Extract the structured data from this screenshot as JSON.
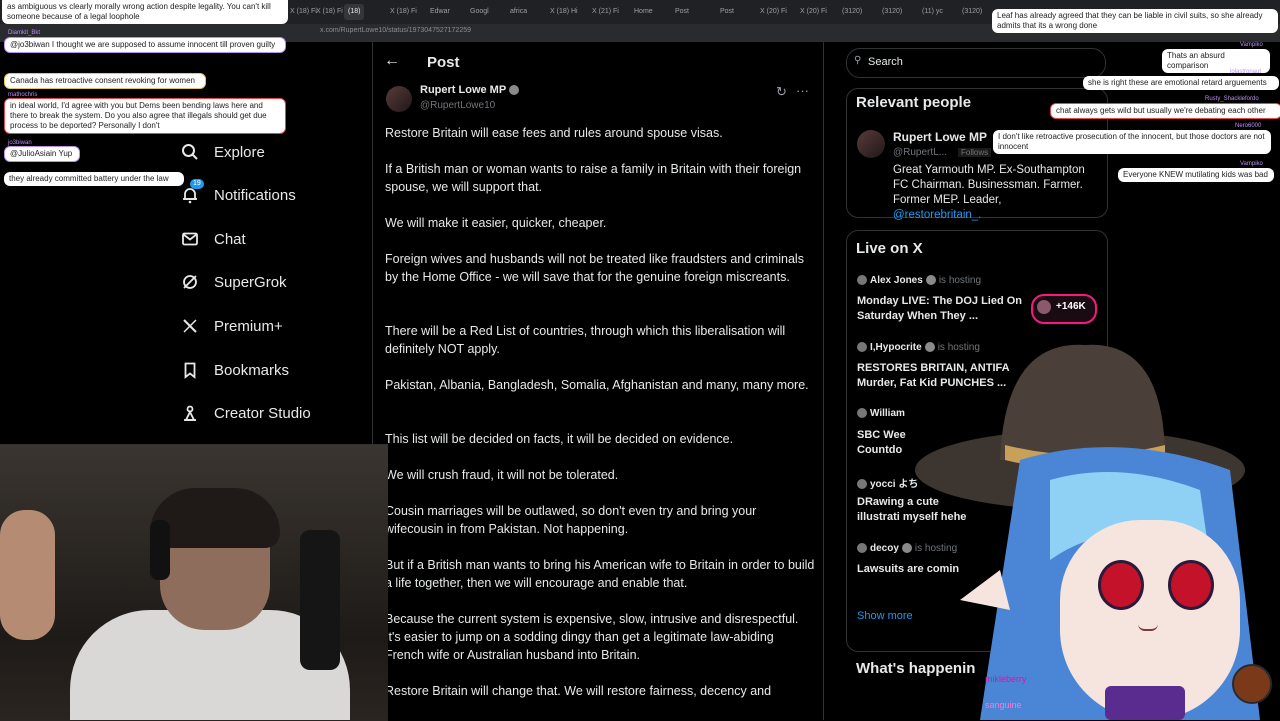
{
  "browser": {
    "tabs": [
      "X (18) Fi",
      "X (18) Fi",
      "(18)",
      "X (18) Fi",
      "Edwar",
      "Googl",
      "africa",
      "X (18) Hi",
      "X (21) Fi",
      "Home",
      "Post",
      "Post",
      "X (20) Fi",
      "X (20) Fi",
      "(3120)",
      "(3120)",
      "(11) yc",
      "(3120)"
    ],
    "url": "x.com/RupertLowe10/status/1973047527172259"
  },
  "nav": {
    "items": [
      {
        "label": "Explore",
        "icon": "search-icon"
      },
      {
        "label": "Notifications",
        "icon": "bell-icon",
        "badge": "19"
      },
      {
        "label": "Chat",
        "icon": "mail-icon"
      },
      {
        "label": "SuperGrok",
        "icon": "grok-icon"
      },
      {
        "label": "Premium+",
        "icon": "x-logo-icon"
      },
      {
        "label": "Bookmarks",
        "icon": "bookmark-icon"
      },
      {
        "label": "Creator Studio",
        "icon": "creator-icon"
      }
    ]
  },
  "post": {
    "header": "Post",
    "author": "Rupert Lowe MP",
    "handle": "@RupertLowe10",
    "paragraphs": [
      "Restore Britain will ease fees and rules around spouse visas.",
      "If a British man or woman wants to raise a family in Britain with their foreign spouse, we will support that.",
      "We will make it easier, quicker, cheaper.",
      "Foreign wives and husbands will not be treated like fraudsters and criminals by the Home Office - we will save that for the genuine foreign miscreants.",
      "There will be a Red List of countries, through which this liberalisation will definitely NOT apply.",
      "Pakistan, Albania, Bangladesh, Somalia, Afghanistan and many, many more.",
      "This list will be decided on facts, it will be decided on evidence.",
      "We will crush fraud, it will not be tolerated.",
      "Cousin marriages will be outlawed, so don't even try and bring your wifecousin in from Pakistan. Not happening.",
      "But if a British man wants to bring his American wife to Britain in order to build a life together, then we will encourage and enable that.",
      "Because the current system is expensive, slow, intrusive and disrespectful. It's easier to jump on a sodding dingy than get a legitimate law-abiding French wife or Australian husband into Britain.",
      "Restore Britain will change that. We will restore fairness, decency and"
    ]
  },
  "right": {
    "search_placeholder": "Search",
    "relevant_title": "Relevant people",
    "relevant": {
      "name": "Rupert Lowe MP",
      "handle": "@RupertL...",
      "follows": "Follows",
      "bio": "Great Yarmouth MP. Ex-Southampton FC Chairman. Businessman. Farmer. Former MEP. Leader,",
      "bio_link": "@restorebritain_."
    },
    "live_title": "Live on X",
    "live": [
      {
        "host": "Alex Jones",
        "status": "is hosting",
        "title": "Monday LIVE: The DOJ Lied On Saturday When They ..."
      },
      {
        "host": "I,Hypocrite",
        "status": "is hosting",
        "title": "RESTORES BRITAIN, ANTIFA Murder, Fat Kid PUNCHES ..."
      },
      {
        "host": "William",
        "status": "",
        "title": "SBC Wee Countdo"
      },
      {
        "host": "yocci よち",
        "status": "",
        "title": "DRawing a cute illustrati myself hehe"
      },
      {
        "host": "decoy",
        "status": "is hosting",
        "title": "Lawsuits are comin"
      }
    ],
    "viewers": "+146K",
    "show_more": "Show more",
    "happening": "What's happenin"
  },
  "chat": [
    {
      "text": "as ambiguous vs clearly morally wrong action despite legality. You can't kill someone because of a legal loophole"
    },
    {
      "user": "Diamkit_Bkt",
      "text": "@jo3biwan I thought we are supposed to assume innocent till proven guilty"
    },
    {
      "text": "Canada has retroactive consent revoking for women"
    },
    {
      "user": "mathochris",
      "text": "in ideal world, I'd agree with you but Dems been bending laws here and there to break the system. Do you also agree that illegals should get due process to be deported? Personally I don't"
    },
    {
      "user": "jo3biwan",
      "text": "@JulioAsiain Yup"
    },
    {
      "text": "they already committed battery under the law"
    },
    {
      "text": "Leaf has already agreed that they can be liable in civil suits, so she already admits that its a wrong done"
    },
    {
      "user": "Vampiko",
      "text": "Thats an absurd comparison"
    },
    {
      "user": "lolastronaut",
      "text": "she is right these are emotional retard arguements"
    },
    {
      "user": "Rusty_Shacklefordo",
      "text": "chat always gets wild but usually we're debating each other"
    },
    {
      "user": "Nero6000",
      "text": "I don't like retroactive prosecution of the innocent, but those doctors are not innocent"
    },
    {
      "user": "Vampiko",
      "text": "Everyone KNEW mutilating kids was bad"
    }
  ],
  "overlay": {
    "name1": "mikleberry",
    "name2": "sanguine"
  }
}
